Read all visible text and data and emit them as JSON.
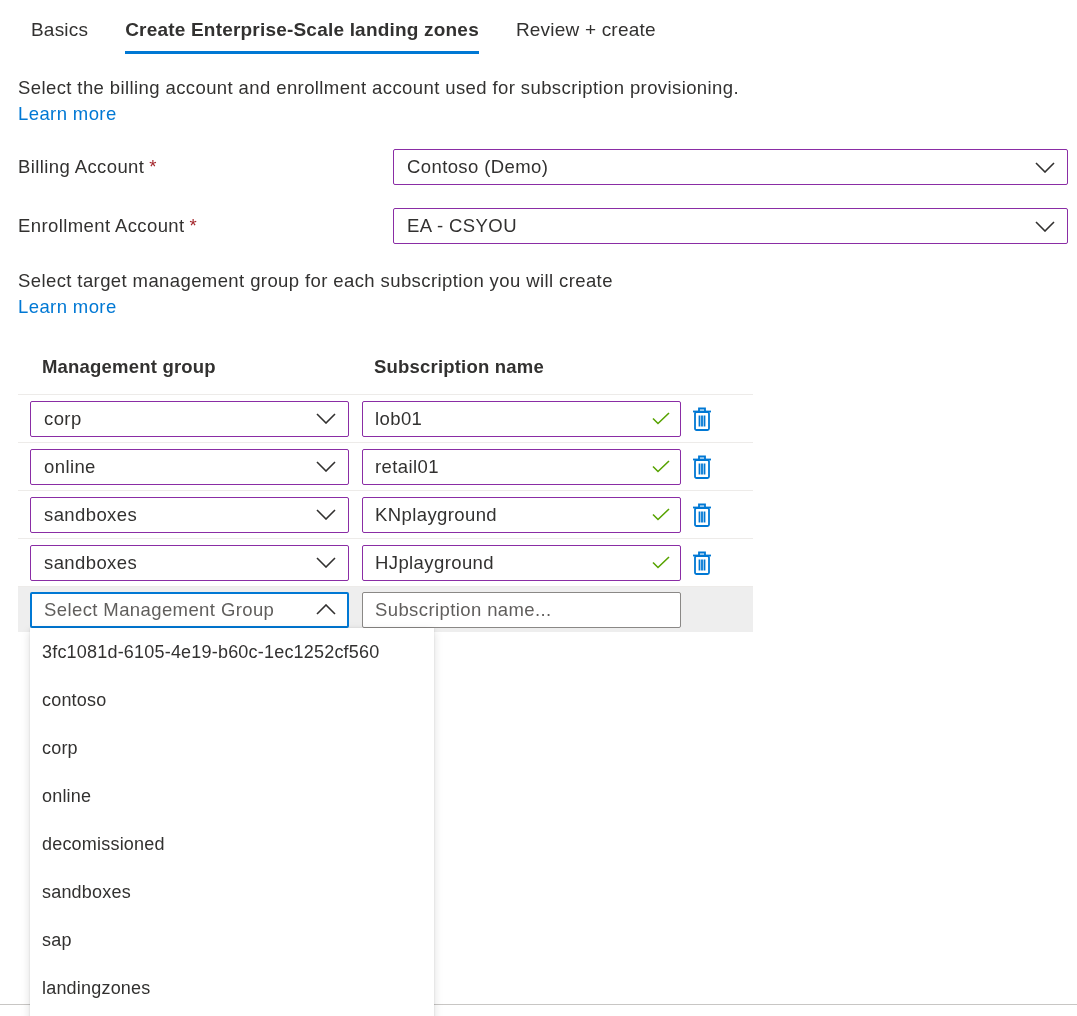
{
  "tabs": [
    {
      "label": "Basics",
      "selected": false
    },
    {
      "label": "Create Enterprise-Scale landing zones",
      "selected": true
    },
    {
      "label": "Review + create",
      "selected": false
    }
  ],
  "billing": {
    "description": "Select the billing account and enrollment account used for subscription provisioning.",
    "link": "Learn more",
    "fields": [
      {
        "label": "Billing Account",
        "required_mark": "*",
        "value": "Contoso (Demo)",
        "edited": true
      },
      {
        "label": "Enrollment Account",
        "required_mark": "*",
        "value": "EA - CSYOU",
        "edited": true
      }
    ]
  },
  "subscriptions": {
    "description": "Select target management group for each subscription you will create",
    "link": "Learn more",
    "table": {
      "columns": [
        "Management group",
        "Subscription name"
      ],
      "rows": [
        {
          "management_group": {
            "value": "corp",
            "edited": true
          },
          "subscription_name": {
            "value": "lob01",
            "edited": true,
            "valid": true
          }
        },
        {
          "management_group": {
            "value": "online",
            "edited": true
          },
          "subscription_name": {
            "value": "retail01",
            "edited": true,
            "valid": true
          }
        },
        {
          "management_group": {
            "value": "sandboxes",
            "edited": true
          },
          "subscription_name": {
            "value": "KNplayground",
            "edited": true,
            "valid": true
          }
        },
        {
          "management_group": {
            "value": "sandboxes",
            "edited": true
          },
          "subscription_name": {
            "value": "HJplayground",
            "edited": true,
            "valid": true
          }
        }
      ],
      "new_row": {
        "management_group": {
          "placeholder": "Select Management Group",
          "expanded": true,
          "options": [
            "3fc1081d-6105-4e19-b60c-1ec1252cf560",
            "contoso",
            "corp",
            "online",
            "decomissioned",
            "sandboxes",
            "sap",
            "landingzones"
          ]
        },
        "subscription_name": {
          "placeholder": "Subscription name...",
          "edited": false
        }
      }
    }
  }
}
